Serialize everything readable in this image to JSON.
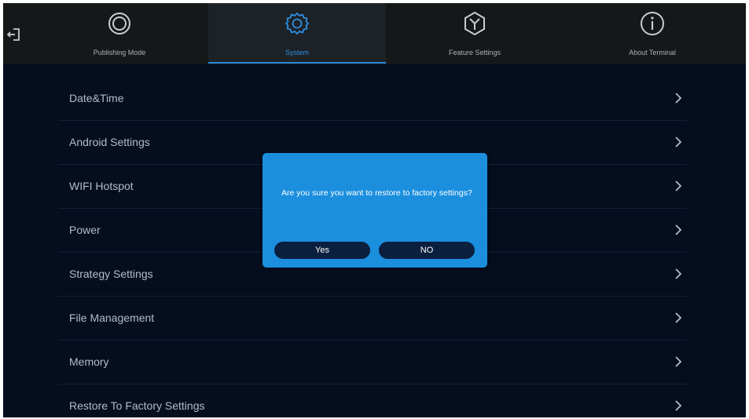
{
  "tabs": [
    {
      "label": "Publishing Mode",
      "icon": "publishing-mode-icon"
    },
    {
      "label": "System",
      "icon": "gear-icon"
    },
    {
      "label": "Feature Settings",
      "icon": "feature-settings-icon"
    },
    {
      "label": "About Terminal",
      "icon": "info-icon"
    }
  ],
  "active_tab": "System",
  "menu": [
    {
      "label": "Date&Time"
    },
    {
      "label": "Android Settings"
    },
    {
      "label": "WIFI Hotspot"
    },
    {
      "label": "Power"
    },
    {
      "label": "Strategy Settings"
    },
    {
      "label": "File Management"
    },
    {
      "label": "Memory"
    },
    {
      "label": "Restore To Factory Settings"
    }
  ],
  "dialog": {
    "message": "Are you sure you want to restore to factory settings?",
    "yes_label": "Yes",
    "no_label": "NO"
  },
  "colors": {
    "background": "#040e1f",
    "topbar": "#151819",
    "accent": "#2b85d4",
    "dialog": "#1b8fde",
    "dialog_button": "#0b1f3f"
  }
}
